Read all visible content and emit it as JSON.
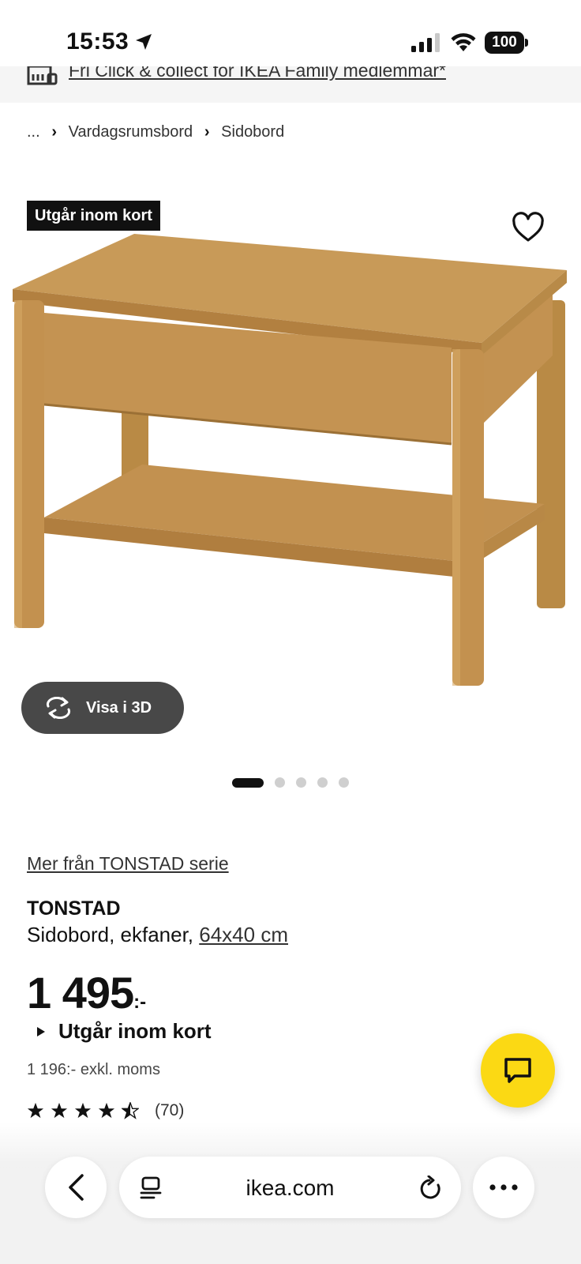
{
  "status_bar": {
    "time": "15:53",
    "battery": "100"
  },
  "promo": {
    "text": "Fri Click & collect för IKEA Family medlemmar*"
  },
  "breadcrumb": {
    "ellipsis": "...",
    "items": [
      "Vardagsrumsbord",
      "Sidobord"
    ]
  },
  "product": {
    "badge": "Utgår inom kort",
    "view_3d": "Visa i 3D",
    "image_count": 5,
    "active_image": 1,
    "series_link": "Mer från TONSTAD serie",
    "name": "TONSTAD",
    "description": "Sidobord, ekfaner, ",
    "size": "64x40 cm",
    "price": "1 495",
    "price_suffix": ":-",
    "availability": "Utgår inom kort",
    "price_ex_vat": "1 196:- exkl. moms",
    "rating": 4.5,
    "review_count": "(70)"
  },
  "browser": {
    "url": "ikea.com"
  },
  "colors": {
    "accent_yellow": "#fbd914",
    "dark": "#111111",
    "button_gray": "#484848",
    "wood": "#c8964e"
  },
  "icons": [
    "location-arrow-icon",
    "signal-icon",
    "wifi-icon",
    "battery-icon",
    "store-icon",
    "chevron-right-icon",
    "heart-icon",
    "rotate-3d-icon",
    "triangle-icon",
    "star-icon",
    "chat-icon",
    "back-icon",
    "reader-icon",
    "reload-icon",
    "more-icon"
  ]
}
